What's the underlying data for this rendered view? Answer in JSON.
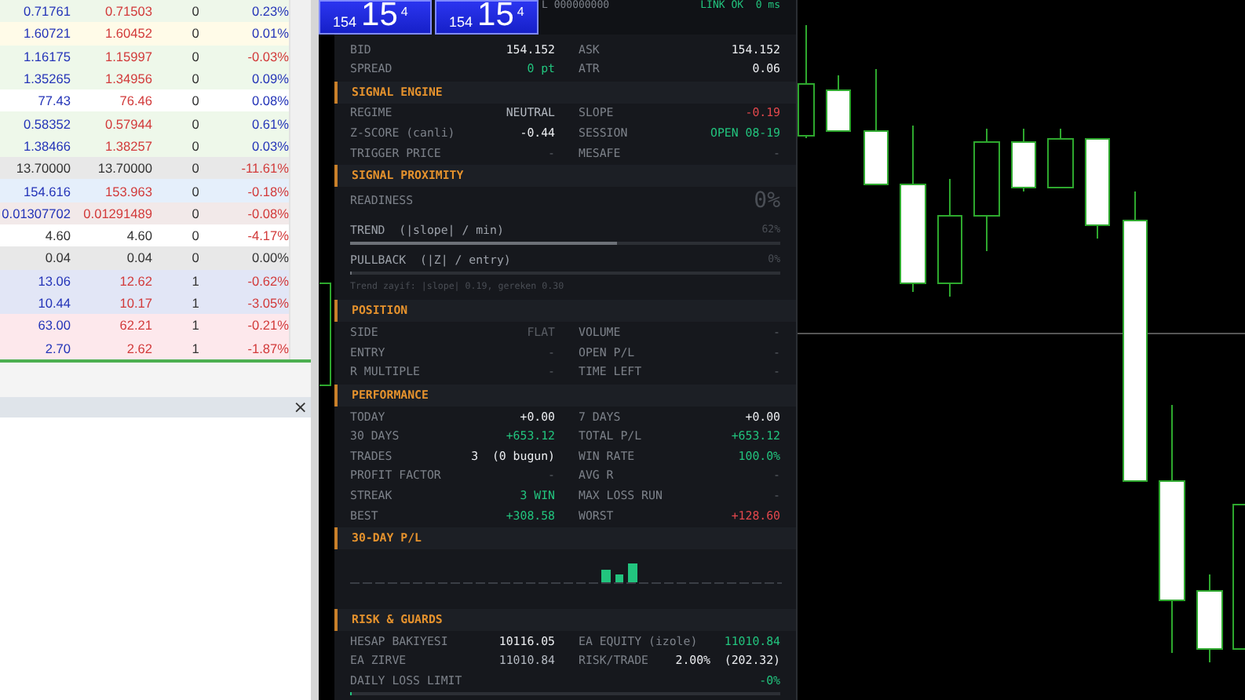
{
  "market_watch": {
    "rows": [
      {
        "column_1": "0.71761",
        "column_2": "0.71503",
        "column_3": "0",
        "column_4": "0.23%",
        "color": "#eef7ea",
        "quoted": true,
        "positive": true,
        "negative": false
      },
      {
        "column_1": "1.60721",
        "column_2": "1.60452",
        "column_3": "0",
        "column_4": "0.01%",
        "color": "#fffbe8",
        "quoted": true,
        "positive": true,
        "negative": false
      },
      {
        "column_1": "1.16175",
        "column_2": "1.15997",
        "column_3": "0",
        "column_4": "-0.03%",
        "color": "#eef8ea",
        "quoted": true,
        "positive": false,
        "negative": true
      },
      {
        "column_1": "1.35265",
        "column_2": "1.34956",
        "column_3": "0",
        "column_4": "0.09%",
        "color": "#eef8ea",
        "quoted": true,
        "positive": true,
        "negative": false
      },
      {
        "column_1": "77.43",
        "column_2": "76.46",
        "column_3": "0",
        "column_4": "0.08%",
        "color": "#ffffff",
        "quoted": true,
        "positive": true,
        "negative": false
      },
      {
        "column_1": "0.58352",
        "column_2": "0.57944",
        "column_3": "0",
        "column_4": "0.61%",
        "color": "#eef8ea",
        "quoted": true,
        "positive": true,
        "negative": false
      },
      {
        "column_1": "1.38466",
        "column_2": "1.38257",
        "column_3": "0",
        "column_4": "0.03%",
        "color": "#eef8ea",
        "quoted": true,
        "positive": true,
        "negative": false
      },
      {
        "column_1": "13.70000",
        "column_2": "13.70000",
        "column_3": "0",
        "column_4": "-11.61%",
        "color": "#e8e8e8",
        "quoted": false,
        "positive": false,
        "negative": true
      },
      {
        "column_1": "154.616",
        "column_2": "153.963",
        "column_3": "0",
        "column_4": "-0.18%",
        "color": "#e5effb",
        "quoted": true,
        "positive": false,
        "negative": true
      },
      {
        "column_1": "0.01307702",
        "column_2": "0.01291489",
        "column_3": "0",
        "column_4": "-0.08%",
        "color": "#f2e9e9",
        "quoted": true,
        "positive": false,
        "negative": true
      },
      {
        "column_1": "4.60",
        "column_2": "4.60",
        "column_3": "0",
        "column_4": "-4.17%",
        "color": "#ffffff",
        "quoted": false,
        "positive": false,
        "negative": true
      },
      {
        "column_1": "0.04",
        "column_2": "0.04",
        "column_3": "0",
        "column_4": "0.00%",
        "color": "#e8e8e8",
        "quoted": false,
        "positive": false,
        "negative": false
      },
      {
        "column_1": "13.06",
        "column_2": "12.62",
        "column_3": "1",
        "column_4": "-0.62%",
        "color": "#e2e6f6",
        "quoted": true,
        "positive": false,
        "negative": true
      },
      {
        "column_1": "10.44",
        "column_2": "10.17",
        "column_3": "1",
        "column_4": "-3.05%",
        "color": "#e2e6f6",
        "quoted": true,
        "positive": false,
        "negative": true
      },
      {
        "column_1": "63.00",
        "column_2": "62.21",
        "column_3": "1",
        "column_4": "-0.21%",
        "color": "#fde8ec",
        "quoted": true,
        "positive": false,
        "negative": true
      },
      {
        "column_1": "2.70",
        "column_2": "2.62",
        "column_3": "1",
        "column_4": "-1.87%",
        "color": "#fde8ec",
        "quoted": true,
        "positive": false,
        "negative": true
      }
    ]
  },
  "bottom_panel": {
    "close": "×"
  },
  "price_buttons": [
    {
      "small": "154",
      "big": "15",
      "sup": "4"
    },
    {
      "small": "154",
      "big": "15",
      "sup": "4"
    }
  ],
  "ea_panel": {
    "account": "L 000000000",
    "link": "LINK OK  0 ms",
    "sections": [
      {
        "kind": "grid",
        "rows": [
          {
            "cells": [
              {
                "label": "BID",
                "value": "154.152",
                "color": "#eceef1"
              },
              {
                "label": "ASK",
                "value": "154.152",
                "color": "#eceef1"
              }
            ]
          },
          {
            "cells": [
              {
                "label": "SPREAD",
                "value": "0 pt",
                "color": "#22c47e"
              },
              {
                "label": "ATR",
                "value": "0.06",
                "color": "#eceef1"
              }
            ]
          }
        ]
      },
      {
        "kind": "grid",
        "title": "SIGNAL ENGINE",
        "rows": [
          {
            "cells": [
              {
                "label": "REGIME",
                "value": "NEUTRAL",
                "color": "#b4b9c1"
              },
              {
                "label": "SLOPE",
                "value": "-0.19",
                "color": "#e5484d"
              }
            ]
          },
          {
            "cells": [
              {
                "label": "Z-SCORE (canli)",
                "value": "-0.44",
                "color": "#eceef1"
              },
              {
                "label": "SESSION",
                "value": "OPEN 08-19",
                "color": "#22c47e"
              }
            ]
          },
          {
            "cells": [
              {
                "label": "TRIGGER PRICE",
                "value": "-"
              },
              {
                "label": "MESAFE",
                "value": "-"
              }
            ]
          }
        ]
      },
      {
        "kind": "proximity",
        "title": "SIGNAL PROXIMITY",
        "readiness_label": "READINESS",
        "readiness": "0%",
        "meters": [
          {
            "label": "TREND  (|slope| / min)",
            "reading": "62%",
            "level": 0.62
          },
          {
            "label": "PULLBACK  (|Z| / entry)",
            "reading": "0%",
            "level": 0
          }
        ],
        "note": "Trend zayif: |slope| 0.19, gereken 0.30"
      },
      {
        "kind": "grid",
        "title": "POSITION",
        "rows": [
          {
            "cells": [
              {
                "label": "SIDE",
                "value": "FLAT",
                "color": "#5a5e65"
              },
              {
                "label": "VOLUME",
                "value": "-"
              }
            ]
          },
          {
            "cells": [
              {
                "label": "ENTRY",
                "value": "-"
              },
              {
                "label": "OPEN P/L",
                "value": "-"
              }
            ]
          },
          {
            "cells": [
              {
                "label": "R MULTIPLE",
                "value": "-"
              },
              {
                "label": "TIME LEFT",
                "value": "-"
              }
            ]
          }
        ]
      },
      {
        "kind": "grid",
        "title": "PERFORMANCE",
        "rows": [
          {
            "cells": [
              {
                "label": "TODAY",
                "value": "+0.00",
                "color": "#eceef1"
              },
              {
                "label": "7 DAYS",
                "value": "+0.00",
                "color": "#eceef1"
              }
            ]
          },
          {
            "cells": [
              {
                "label": "30 DAYS",
                "value": "+653.12",
                "color": "#22c47e"
              },
              {
                "label": "TOTAL P/L",
                "value": "+653.12",
                "color": "#22c47e"
              }
            ]
          },
          {
            "cells": [
              {
                "label": "TRADES",
                "value": "3  (0 bugun)",
                "color": "#eceef1"
              },
              {
                "label": "WIN RATE",
                "value": "100.0%",
                "color": "#22c47e"
              }
            ]
          },
          {
            "cells": [
              {
                "label": "PROFIT FACTOR",
                "value": "-"
              },
              {
                "label": "AVG R",
                "value": "-"
              }
            ]
          },
          {
            "cells": [
              {
                "label": "STREAK",
                "value": "3 WIN",
                "color": "#22c47e"
              },
              {
                "label": "MAX LOSS RUN",
                "value": "-"
              }
            ]
          },
          {
            "cells": [
              {
                "label": "BEST",
                "value": "+308.58",
                "color": "#22c47e"
              },
              {
                "label": "WORST",
                "value": "+128.60",
                "color": "#e5484d"
              }
            ]
          }
        ]
      },
      {
        "kind": "sparkline",
        "title": "30-DAY P/L"
      },
      {
        "kind": "grid",
        "title": "RISK & GUARDS",
        "rows": [
          {
            "cells": [
              {
                "label": "HESAP BAKIYESI",
                "value": "10116.05",
                "color": "#eceef1"
              },
              {
                "label": "EA EQUITY (izole)",
                "value": "11010.84",
                "color": "#22c47e"
              }
            ]
          },
          {
            "cells": [
              {
                "label": "EA ZIRVE",
                "value": "11010.84",
                "color": "#b4b9c1"
              },
              {
                "label": "RISK/TRADE",
                "value": "2.00%  (202.32)",
                "color": "#eceef1"
              }
            ]
          }
        ],
        "meter": {
          "label": "DAILY LOSS LIMIT",
          "reading": "-0%",
          "color": "#22c47e",
          "level": 0
        }
      }
    ]
  }
}
